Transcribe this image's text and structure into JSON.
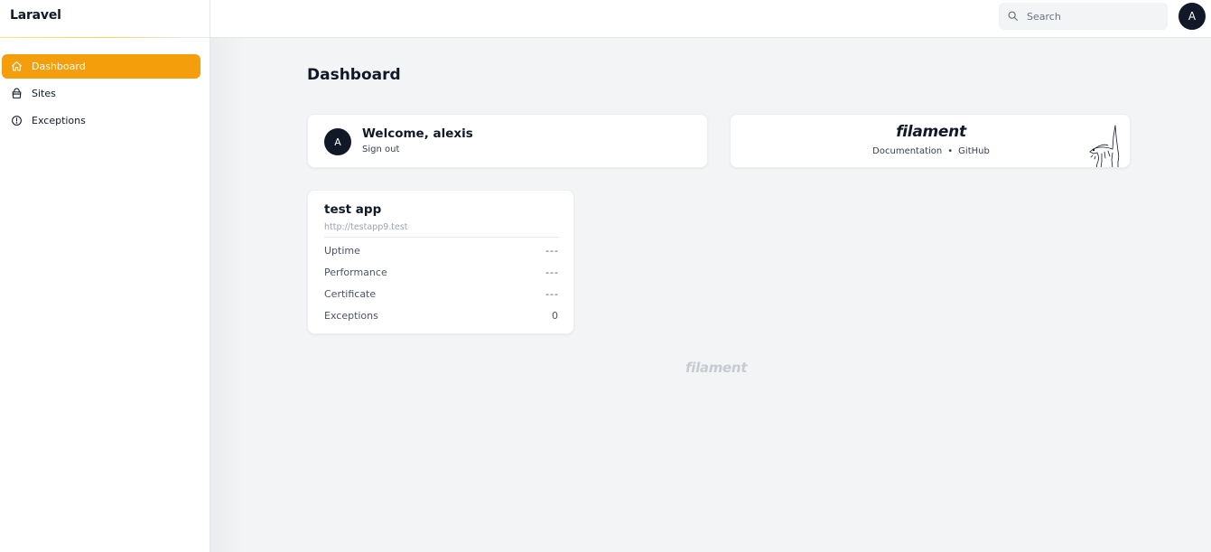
{
  "brand": {
    "name": "Laravel"
  },
  "sidebar": {
    "items": [
      {
        "label": "Dashboard",
        "icon": "home-icon",
        "active": true
      },
      {
        "label": "Sites",
        "icon": "shopping-bag-icon",
        "active": false
      },
      {
        "label": "Exceptions",
        "icon": "exclamation-circle-icon",
        "active": false
      }
    ]
  },
  "topbar": {
    "search_placeholder": "Search",
    "avatar_initial": "A"
  },
  "page": {
    "title": "Dashboard"
  },
  "welcome": {
    "avatar_initial": "A",
    "title": "Welcome, alexis",
    "signout": "Sign out"
  },
  "filament": {
    "logo": "filament",
    "links": {
      "documentation": "Documentation",
      "separator": "•",
      "github": "GitHub"
    }
  },
  "site": {
    "name": "test app",
    "url": "http://testapp9.test",
    "metrics": [
      {
        "label": "Uptime",
        "value": "---"
      },
      {
        "label": "Performance",
        "value": "---"
      },
      {
        "label": "Certificate",
        "value": "---"
      },
      {
        "label": "Exceptions",
        "value": "0"
      }
    ]
  },
  "footer": {
    "logo": "filament"
  },
  "colors": {
    "accent": "#f59e0b",
    "dark": "#111827",
    "background": "#f3f4f6"
  }
}
